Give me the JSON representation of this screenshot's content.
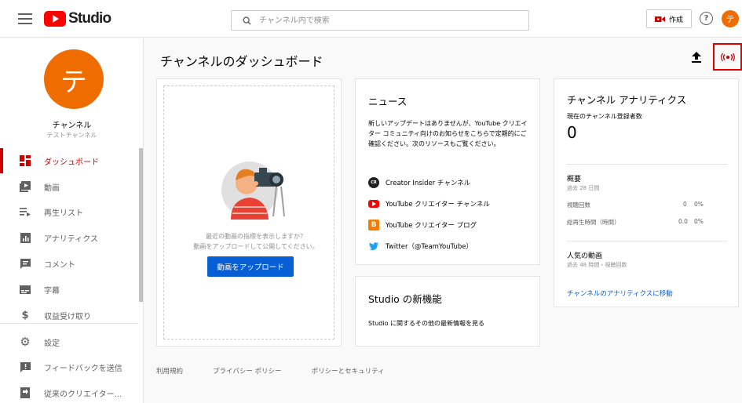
{
  "header": {
    "logo_text": "Studio",
    "search_placeholder": "チャンネル内で検索",
    "create_label": "作成",
    "help_glyph": "?",
    "avatar_letter": "テ",
    "colors": {
      "brand": "#ff0000",
      "avatar": "#ef6c00"
    }
  },
  "sidebar": {
    "avatar_letter": "テ",
    "channel_label": "チャンネル",
    "channel_sub": "テストチャンネル",
    "items": [
      {
        "label": "ダッシュボード",
        "icon": "dashboard-icon",
        "active": true
      },
      {
        "label": "動画",
        "icon": "video-icon"
      },
      {
        "label": "再生リスト",
        "icon": "playlist-icon"
      },
      {
        "label": "アナリティクス",
        "icon": "analytics-icon"
      },
      {
        "label": "コメント",
        "icon": "comment-icon"
      },
      {
        "label": "字幕",
        "icon": "subtitle-icon"
      },
      {
        "label": "収益受け取り",
        "icon": "dollar-icon"
      },
      {
        "label": "設定",
        "icon": "gear-icon"
      },
      {
        "label": "フィードバックを送信",
        "icon": "feedback-icon"
      },
      {
        "label": "従来のクリエイター...",
        "icon": "classic-studio-icon"
      }
    ]
  },
  "main": {
    "title": "チャンネルのダッシュボード",
    "upload_card": {
      "hint_line1": "最近の動画の指標を表示しますか？",
      "hint_line2": "動画をアップロードして公開してください。",
      "button_label": "動画をアップロード"
    },
    "news_card": {
      "title": "ニュース",
      "text": "新しいアップデートはありませんが、YouTube クリエイター コミュニティ向けのお知らせをこちらで定期的にご確認ください。次のリソースもご覧ください。",
      "links": [
        {
          "label": "Creator Insider チャンネル",
          "icon": "creator-insider-icon",
          "badge": "CR"
        },
        {
          "label": "YouTube クリエイター チャンネル",
          "icon": "youtube-icon"
        },
        {
          "label": "YouTube クリエイター ブログ",
          "icon": "blogger-icon"
        },
        {
          "label": "Twitter（@TeamYouTube）",
          "icon": "twitter-icon"
        }
      ]
    },
    "studio_card": {
      "title": "Studio の新機能",
      "text": "Studio に関するその他の最新情報を見る"
    },
    "analytics_card": {
      "title": "チャンネル アナリティクス",
      "subscribers_label": "現在のチャンネル登録者数",
      "subscribers_value": "0",
      "summary_title": "概要",
      "summary_period": "過去 28 日間",
      "metrics": [
        {
          "label": "視聴回数",
          "value": "0",
          "change": "0%"
        },
        {
          "label": "総再生時間（時間）",
          "value": "0.0",
          "change": "0%"
        }
      ],
      "popular_title": "人気の動画",
      "popular_period": "過去 48 時間・視聴回数",
      "link_label": "チャンネルのアナリティクスに移動"
    },
    "footer": [
      "利用規約",
      "プライバシー ポリシー",
      "ポリシーとセキュリティ"
    ]
  }
}
